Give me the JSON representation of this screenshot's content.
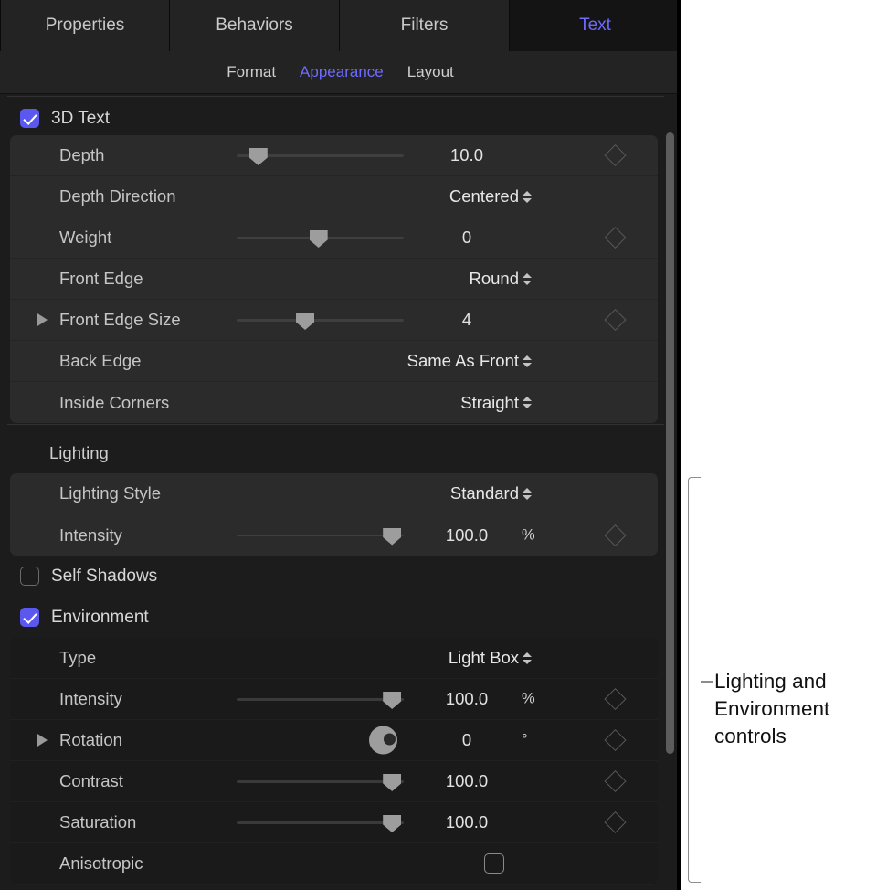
{
  "panel": {
    "tabs": [
      {
        "label": "Properties",
        "active": false
      },
      {
        "label": "Behaviors",
        "active": false
      },
      {
        "label": "Filters",
        "active": false
      },
      {
        "label": "Text",
        "active": true
      }
    ],
    "subtabs": [
      {
        "label": "Format",
        "active": false
      },
      {
        "label": "Appearance",
        "active": true
      },
      {
        "label": "Layout",
        "active": false
      }
    ],
    "three_d_text": {
      "label": "3D Text",
      "checked": true
    },
    "geometry_rows": [
      {
        "label": "Depth",
        "type": "slider",
        "value": "10.0",
        "unit": "",
        "knob_pct": 13,
        "keyframe": true,
        "disclosure": false
      },
      {
        "label": "Depth Direction",
        "type": "popup",
        "value": "Centered",
        "keyframe": false,
        "disclosure": false
      },
      {
        "label": "Weight",
        "type": "slider",
        "value": "0",
        "unit": "",
        "knob_pct": 49,
        "keyframe": true,
        "disclosure": false
      },
      {
        "label": "Front Edge",
        "type": "popup",
        "value": "Round",
        "keyframe": false,
        "disclosure": false
      },
      {
        "label": "Front Edge Size",
        "type": "slider",
        "value": "4",
        "unit": "",
        "knob_pct": 41,
        "keyframe": true,
        "disclosure": true
      },
      {
        "label": "Back Edge",
        "type": "popup",
        "value": "Same As Front",
        "keyframe": false,
        "disclosure": false
      },
      {
        "label": "Inside Corners",
        "type": "popup",
        "value": "Straight",
        "keyframe": false,
        "disclosure": false
      }
    ],
    "lighting_header": "Lighting",
    "lighting_rows": [
      {
        "label": "Lighting Style",
        "type": "popup",
        "value": "Standard",
        "keyframe": false,
        "disclosure": false
      },
      {
        "label": "Intensity",
        "type": "slider",
        "value": "100.0",
        "unit": "%",
        "knob_pct": 93,
        "keyframe": true,
        "disclosure": false
      }
    ],
    "self_shadows": {
      "label": "Self Shadows",
      "checked": false
    },
    "environment": {
      "label": "Environment",
      "checked": true
    },
    "environment_rows": [
      {
        "label": "Type",
        "type": "popup",
        "value": "Light Box",
        "keyframe": false,
        "disclosure": false
      },
      {
        "label": "Intensity",
        "type": "slider",
        "value": "100.0",
        "unit": "%",
        "knob_pct": 93,
        "keyframe": true,
        "disclosure": false
      },
      {
        "label": "Rotation",
        "type": "dial",
        "value": "0",
        "unit": "°",
        "keyframe": true,
        "disclosure": true
      },
      {
        "label": "Contrast",
        "type": "slider",
        "value": "100.0",
        "unit": "",
        "knob_pct": 93,
        "keyframe": true,
        "disclosure": false
      },
      {
        "label": "Saturation",
        "type": "slider",
        "value": "100.0",
        "unit": "",
        "knob_pct": 93,
        "keyframe": true,
        "disclosure": false
      },
      {
        "label": "Anisotropic",
        "type": "checkbox",
        "checked": false,
        "keyframe": false,
        "disclosure": false
      }
    ]
  },
  "annotation": {
    "text": "Lighting and\nEnvironment\ncontrols"
  },
  "colors": {
    "accent": "#5b58f0",
    "accent_text": "#6e6aff",
    "panel_bg": "#1c1c1c",
    "group_bg": "#2b2b2b",
    "group_dark_bg": "#1a1a1a",
    "tab_bg": "#232323",
    "label_text": "#c6c6c6",
    "value_text": "#e2e2e2",
    "knob": "#9d9d9d",
    "track": "#3f3f3f",
    "keyframe": "#585858",
    "scrollbar": "#5c5c5c",
    "annotation_line": "#8c8c8c",
    "annotation_text": "#111111"
  }
}
